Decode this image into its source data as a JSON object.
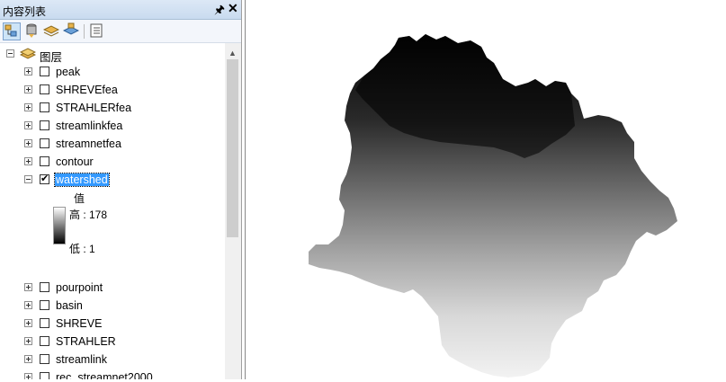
{
  "panel": {
    "title": "内容列表"
  },
  "tree": {
    "root_label": "图层",
    "layers_top": [
      {
        "name": "peak",
        "checked": false
      },
      {
        "name": "SHREVEfea",
        "checked": false
      },
      {
        "name": "STRAHLERfea",
        "checked": false
      },
      {
        "name": "streamlinkfea",
        "checked": false
      },
      {
        "name": "streamnetfea",
        "checked": false
      },
      {
        "name": "contour",
        "checked": false
      }
    ],
    "active_layer": {
      "name": "watershed",
      "checked": true
    },
    "legend": {
      "heading": "值",
      "high": "高 : 178",
      "low": "低 : 1"
    },
    "layers_bottom": [
      {
        "name": "pourpoint",
        "checked": false
      },
      {
        "name": "basin",
        "checked": false
      },
      {
        "name": "SHREVE",
        "checked": false
      },
      {
        "name": "STRAHLER",
        "checked": false
      },
      {
        "name": "streamlink",
        "checked": false
      },
      {
        "name": "rec_streamnet2000",
        "checked": false
      }
    ]
  },
  "colors": {
    "selection": "#3399ff",
    "panel_header": "#dce8f6"
  }
}
